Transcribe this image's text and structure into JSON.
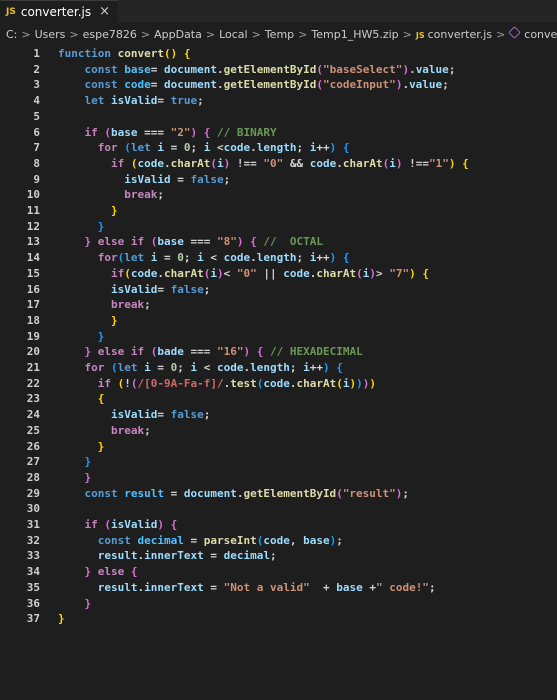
{
  "tab": {
    "icon": "js-file-icon",
    "badge": "JS",
    "title": "converter.js",
    "close": "×"
  },
  "breadcrumb": {
    "items": [
      "C:",
      "Users",
      "espe7826",
      "AppData",
      "Local",
      "Temp",
      "Temp1_HW5.zip",
      "converter.js",
      "convert"
    ],
    "separator": ">",
    "js_badge": "JS"
  },
  "colors": {
    "background": "#1e1e1e",
    "keyword": "#569cd6",
    "control": "#c586c0",
    "function": "#dcdcaa",
    "variable": "#9cdcfe",
    "string": "#ce9178",
    "number": "#b5cea8",
    "comment": "#6a9955"
  },
  "code": {
    "lines": [
      [
        [
          "kw",
          "function "
        ],
        [
          "fn",
          "convert"
        ],
        [
          "br1",
          "() {"
        ]
      ],
      [
        [
          "pun",
          "    "
        ],
        [
          "kw",
          "const "
        ],
        [
          "con",
          "base"
        ],
        [
          "pun",
          "= "
        ],
        [
          "var",
          "document"
        ],
        [
          "pun",
          "."
        ],
        [
          "fn",
          "getElementById"
        ],
        [
          "br2",
          "("
        ],
        [
          "str",
          "\"baseSelect\""
        ],
        [
          "br2",
          ")"
        ],
        [
          "pun",
          "."
        ],
        [
          "var",
          "value"
        ],
        [
          "pun",
          ";"
        ]
      ],
      [
        [
          "pun",
          "    "
        ],
        [
          "kw",
          "const "
        ],
        [
          "con",
          "code"
        ],
        [
          "pun",
          "= "
        ],
        [
          "var",
          "document"
        ],
        [
          "pun",
          "."
        ],
        [
          "fn",
          "getElementById"
        ],
        [
          "br2",
          "("
        ],
        [
          "str",
          "\"codeInput\""
        ],
        [
          "br2",
          ")"
        ],
        [
          "pun",
          "."
        ],
        [
          "var",
          "value"
        ],
        [
          "pun",
          ";"
        ]
      ],
      [
        [
          "pun",
          "    "
        ],
        [
          "kw",
          "let "
        ],
        [
          "var",
          "isValid"
        ],
        [
          "pun",
          "= "
        ],
        [
          "kw",
          "true"
        ],
        [
          "pun",
          ";"
        ]
      ],
      [],
      [
        [
          "pun",
          "    "
        ],
        [
          "ctl",
          "if "
        ],
        [
          "br2",
          "("
        ],
        [
          "var",
          "base "
        ],
        [
          "pun",
          "=== "
        ],
        [
          "str",
          "\"2\""
        ],
        [
          "br2",
          ") {"
        ],
        [
          "com",
          " // BINARY"
        ]
      ],
      [
        [
          "pun",
          "      "
        ],
        [
          "ctl",
          "for "
        ],
        [
          "br3",
          "("
        ],
        [
          "kw",
          "let "
        ],
        [
          "var",
          "i "
        ],
        [
          "pun",
          "= "
        ],
        [
          "num",
          "0"
        ],
        [
          "pun",
          "; "
        ],
        [
          "var",
          "i "
        ],
        [
          "pun",
          "<"
        ],
        [
          "var",
          "code"
        ],
        [
          "pun",
          "."
        ],
        [
          "var",
          "length"
        ],
        [
          "pun",
          "; "
        ],
        [
          "var",
          "i"
        ],
        [
          "pun",
          "++"
        ],
        [
          "br3",
          ")"
        ],
        [
          "br3",
          " {"
        ]
      ],
      [
        [
          "pun",
          "        "
        ],
        [
          "ctl",
          "if "
        ],
        [
          "br1",
          "("
        ],
        [
          "var",
          "code"
        ],
        [
          "pun",
          "."
        ],
        [
          "fn",
          "charAt"
        ],
        [
          "br2",
          "("
        ],
        [
          "var",
          "i"
        ],
        [
          "br2",
          ")"
        ],
        [
          "pun",
          " !== "
        ],
        [
          "str",
          "\"0\""
        ],
        [
          "pun",
          " && "
        ],
        [
          "var",
          "code"
        ],
        [
          "pun",
          "."
        ],
        [
          "fn",
          "charAt"
        ],
        [
          "br2",
          "("
        ],
        [
          "var",
          "i"
        ],
        [
          "br2",
          ")"
        ],
        [
          "pun",
          " !=="
        ],
        [
          "str",
          "\"1\""
        ],
        [
          "br1",
          ")"
        ],
        [
          "br1",
          " {"
        ]
      ],
      [
        [
          "pun",
          "          "
        ],
        [
          "var",
          "isValid "
        ],
        [
          "pun",
          "= "
        ],
        [
          "kw",
          "false"
        ],
        [
          "pun",
          ";"
        ]
      ],
      [
        [
          "pun",
          "          "
        ],
        [
          "ctl",
          "break"
        ],
        [
          "pun",
          ";"
        ]
      ],
      [
        [
          "pun",
          "        "
        ],
        [
          "br1",
          "}"
        ]
      ],
      [
        [
          "pun",
          "      "
        ],
        [
          "br3",
          "}"
        ]
      ],
      [
        [
          "pun",
          "    "
        ],
        [
          "br2",
          "}"
        ],
        [
          "ctl",
          " else if "
        ],
        [
          "br2",
          "("
        ],
        [
          "var",
          "base "
        ],
        [
          "pun",
          "=== "
        ],
        [
          "str",
          "\"8\""
        ],
        [
          "br2",
          ")"
        ],
        [
          "br2",
          " {"
        ],
        [
          "com",
          " //  OCTAL"
        ]
      ],
      [
        [
          "pun",
          "      "
        ],
        [
          "ctl",
          "for"
        ],
        [
          "br3",
          "("
        ],
        [
          "kw",
          "let "
        ],
        [
          "var",
          "i "
        ],
        [
          "pun",
          "= "
        ],
        [
          "num",
          "0"
        ],
        [
          "pun",
          "; "
        ],
        [
          "var",
          "i "
        ],
        [
          "pun",
          "< "
        ],
        [
          "var",
          "code"
        ],
        [
          "pun",
          "."
        ],
        [
          "var",
          "length"
        ],
        [
          "pun",
          "; "
        ],
        [
          "var",
          "i"
        ],
        [
          "pun",
          "++"
        ],
        [
          "br3",
          ")"
        ],
        [
          "br3",
          " {"
        ]
      ],
      [
        [
          "pun",
          "        "
        ],
        [
          "ctl",
          "if"
        ],
        [
          "br1",
          "("
        ],
        [
          "var",
          "code"
        ],
        [
          "pun",
          "."
        ],
        [
          "fn",
          "charAt"
        ],
        [
          "br2",
          "("
        ],
        [
          "var",
          "i"
        ],
        [
          "br2",
          ")"
        ],
        [
          "pun",
          "< "
        ],
        [
          "str",
          "\"0\""
        ],
        [
          "pun",
          " || "
        ],
        [
          "var",
          "code"
        ],
        [
          "pun",
          "."
        ],
        [
          "fn",
          "charAt"
        ],
        [
          "br2",
          "("
        ],
        [
          "var",
          "i"
        ],
        [
          "br2",
          ")"
        ],
        [
          "pun",
          "> "
        ],
        [
          "str",
          "\"7\""
        ],
        [
          "br1",
          ")"
        ],
        [
          "br1",
          " {"
        ]
      ],
      [
        [
          "pun",
          "        "
        ],
        [
          "var",
          "isValid"
        ],
        [
          "pun",
          "= "
        ],
        [
          "kw",
          "false"
        ],
        [
          "pun",
          ";"
        ]
      ],
      [
        [
          "pun",
          "        "
        ],
        [
          "ctl",
          "break"
        ],
        [
          "pun",
          ";"
        ]
      ],
      [
        [
          "pun",
          "        "
        ],
        [
          "br1",
          "}"
        ]
      ],
      [
        [
          "pun",
          "      "
        ],
        [
          "br3",
          "}"
        ]
      ],
      [
        [
          "pun",
          "    "
        ],
        [
          "br2",
          "}"
        ],
        [
          "ctl",
          " else if "
        ],
        [
          "br2",
          "("
        ],
        [
          "var",
          "bade "
        ],
        [
          "pun",
          "=== "
        ],
        [
          "str",
          "\"16\""
        ],
        [
          "br2",
          ")"
        ],
        [
          "br2",
          " {"
        ],
        [
          "com",
          " // HEXADECIMAL"
        ]
      ],
      [
        [
          "pun",
          "    "
        ],
        [
          "ctl",
          "for "
        ],
        [
          "br3",
          "("
        ],
        [
          "kw",
          "let "
        ],
        [
          "var",
          "i "
        ],
        [
          "pun",
          "= "
        ],
        [
          "num",
          "0"
        ],
        [
          "pun",
          "; "
        ],
        [
          "var",
          "i "
        ],
        [
          "pun",
          "< "
        ],
        [
          "var",
          "code"
        ],
        [
          "pun",
          "."
        ],
        [
          "var",
          "length"
        ],
        [
          "pun",
          "; "
        ],
        [
          "var",
          "i"
        ],
        [
          "pun",
          "++"
        ],
        [
          "br3",
          ")"
        ],
        [
          "br3",
          " {"
        ]
      ],
      [
        [
          "pun",
          "      "
        ],
        [
          "ctl",
          "if "
        ],
        [
          "br1",
          "("
        ],
        [
          "pun",
          "!"
        ],
        [
          "br2",
          "("
        ],
        [
          "rx",
          "/[0-9A-Fa-f]/"
        ],
        [
          "pun",
          "."
        ],
        [
          "fn",
          "test"
        ],
        [
          "br3",
          "("
        ],
        [
          "var",
          "code"
        ],
        [
          "pun",
          "."
        ],
        [
          "fn",
          "charAt"
        ],
        [
          "br1",
          "("
        ],
        [
          "var",
          "i"
        ],
        [
          "br1",
          ")"
        ],
        [
          "br3",
          ")"
        ],
        [
          "br2",
          ")"
        ],
        [
          "br1",
          ")"
        ]
      ],
      [
        [
          "pun",
          "      "
        ],
        [
          "br1",
          "{"
        ]
      ],
      [
        [
          "pun",
          "        "
        ],
        [
          "var",
          "isValid"
        ],
        [
          "pun",
          "= "
        ],
        [
          "kw",
          "false"
        ],
        [
          "pun",
          ";"
        ]
      ],
      [
        [
          "pun",
          "        "
        ],
        [
          "ctl",
          "break"
        ],
        [
          "pun",
          ";"
        ]
      ],
      [
        [
          "pun",
          "      "
        ],
        [
          "br1",
          "}"
        ]
      ],
      [
        [
          "pun",
          "    "
        ],
        [
          "br3",
          "}"
        ]
      ],
      [
        [
          "pun",
          "    "
        ],
        [
          "br2",
          "}"
        ]
      ],
      [
        [
          "pun",
          "    "
        ],
        [
          "kw",
          "const "
        ],
        [
          "con",
          "result "
        ],
        [
          "pun",
          "= "
        ],
        [
          "var",
          "document"
        ],
        [
          "pun",
          "."
        ],
        [
          "fn",
          "getElementById"
        ],
        [
          "br2",
          "("
        ],
        [
          "str",
          "\"result\""
        ],
        [
          "br2",
          ")"
        ],
        [
          "pun",
          ";"
        ]
      ],
      [],
      [
        [
          "pun",
          "    "
        ],
        [
          "ctl",
          "if "
        ],
        [
          "br2",
          "("
        ],
        [
          "var",
          "isValid"
        ],
        [
          "br2",
          ")"
        ],
        [
          "br2",
          " {"
        ]
      ],
      [
        [
          "pun",
          "      "
        ],
        [
          "kw",
          "const "
        ],
        [
          "con",
          "decimal "
        ],
        [
          "pun",
          "= "
        ],
        [
          "fn",
          "parseInt"
        ],
        [
          "br3",
          "("
        ],
        [
          "var",
          "code"
        ],
        [
          "pun",
          ", "
        ],
        [
          "var",
          "base"
        ],
        [
          "br3",
          ")"
        ],
        [
          "pun",
          ";"
        ]
      ],
      [
        [
          "pun",
          "      "
        ],
        [
          "var",
          "result"
        ],
        [
          "pun",
          "."
        ],
        [
          "var",
          "innerText "
        ],
        [
          "pun",
          "= "
        ],
        [
          "var",
          "decimal"
        ],
        [
          "pun",
          ";"
        ]
      ],
      [
        [
          "pun",
          "    "
        ],
        [
          "br2",
          "}"
        ],
        [
          "ctl",
          " else "
        ],
        [
          "br2",
          "{"
        ]
      ],
      [
        [
          "pun",
          "      "
        ],
        [
          "var",
          "result"
        ],
        [
          "pun",
          "."
        ],
        [
          "var",
          "innerText "
        ],
        [
          "pun",
          "= "
        ],
        [
          "str",
          "\"Not a valid\""
        ],
        [
          "pun",
          "  + "
        ],
        [
          "var",
          "base "
        ],
        [
          "pun",
          "+"
        ],
        [
          "str",
          "\" code!\""
        ],
        [
          "pun",
          ";"
        ]
      ],
      [
        [
          "pun",
          "    "
        ],
        [
          "br2",
          "}"
        ]
      ],
      [
        [
          "br1",
          "}"
        ]
      ]
    ]
  }
}
